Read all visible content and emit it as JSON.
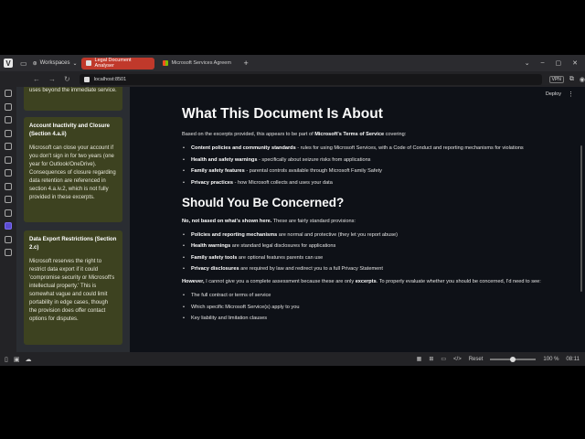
{
  "browser": {
    "workspaces_label": "Workspaces",
    "tabs": [
      {
        "label": "Legal Document Analyser",
        "active": true
      },
      {
        "label": "Microsoft Services Agreem",
        "active": false
      }
    ],
    "url": "localhost:8501",
    "vpn_label": "VPN"
  },
  "app": {
    "deploy_label": "Deploy",
    "sidebar_cards": [
      {
        "title": "",
        "body": "uses beyond the immediate service."
      },
      {
        "title": "Account Inactivity and Closure (Section 4.a.ii)",
        "body": "Microsoft can close your account if you don't sign in for two years (one year for Outlook/OneDrive). Consequences of closure regarding data retention are referenced in section 4.a.iv.2, which is not fully provided in these excerpts."
      },
      {
        "title": "Data Export Restrictions (Section 2.c)",
        "body": "Microsoft reserves the right to restrict data export if it could 'compromise security or Microsoft's intellectual property.' This is somewhat vague and could limit portability in edge cases, though the provision does offer contact options for disputes."
      }
    ],
    "main": {
      "h1": "What This Document Is About",
      "intro_pre": "Based on the excerpts provided, this appears to be part of ",
      "intro_bold": "Microsoft's Terms of Service",
      "intro_post": " covering:",
      "about_items": [
        {
          "bold": "Content policies and community standards",
          "text": " - rules for using Microsoft Services, with a Code of Conduct and reporting mechanisms for violations"
        },
        {
          "bold": "Health and safety warnings",
          "text": " - specifically about seizure risks from applications"
        },
        {
          "bold": "Family safety features",
          "text": " - parental controls available through Microsoft Family Safety"
        },
        {
          "bold": "Privacy practices",
          "text": " - how Microsoft collects and uses your data"
        }
      ],
      "h2": "Should You Be Concerned?",
      "concern_bold": "No, not based on what's shown here.",
      "concern_text": " These are fairly standard provisions:",
      "concern_items": [
        {
          "bold": "Policies and reporting mechanisms",
          "text": " are normal and protective (they let you report abuse)"
        },
        {
          "bold": "Health warnings",
          "text": " are standard legal disclosures for applications"
        },
        {
          "bold": "Family safety tools",
          "text": " are optional features parents can use"
        },
        {
          "bold": "Privacy disclosures",
          "text": " are required by law and redirect you to a full Privacy Statement"
        }
      ],
      "however_bold": "However,",
      "however_mid": " I cannot give you a complete assessment because these are only ",
      "however_bold2": "excerpts",
      "however_post": ". To properly evaluate whether you should be concerned, I'd need to see:",
      "need_items": [
        "The full contract or terms of service",
        "Which specific Microsoft Service(s) apply to you",
        "Key liability and limitation clauses"
      ]
    }
  },
  "statusbar": {
    "reset_label": "Reset",
    "zoom": "100 %",
    "zoom_fraction": 0.5,
    "time": "08:11"
  }
}
